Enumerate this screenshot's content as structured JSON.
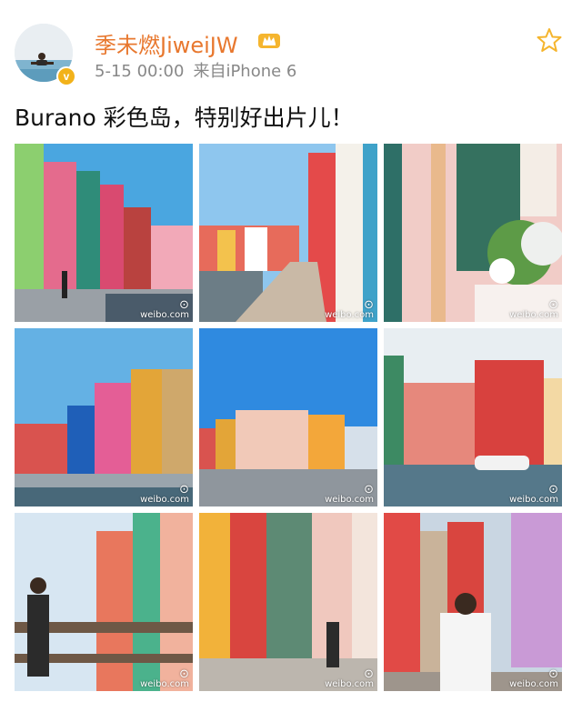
{
  "post": {
    "username": "季未燃JiweiJW",
    "date": "5-15 00:00",
    "source": "来自iPhone 6",
    "text": "Burano 彩色岛，特别好出片儿！",
    "verified_badge": "v",
    "icons": {
      "member": "crown-member-icon",
      "favorite": "star-icon"
    }
  },
  "gallery": {
    "watermark": "weibo.com",
    "count": 9
  }
}
